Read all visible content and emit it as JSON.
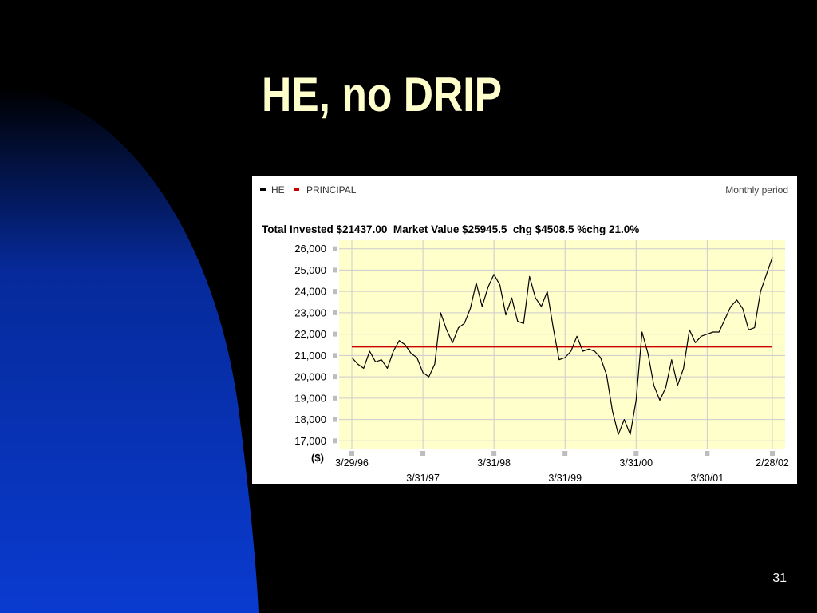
{
  "slide": {
    "title": "HE, no DRIP",
    "page_number": "31"
  },
  "chart_data": {
    "type": "line",
    "legend": [
      {
        "name": "HE",
        "color": "#000000"
      },
      {
        "name": "PRINCIPAL",
        "color": "#cc0000"
      }
    ],
    "period_label": "Monthly period",
    "summary": "Total Invested $21437.00  Market Value $25945.5  chg $4508.5 %chg 21.0%",
    "ylabel": "($)",
    "ylim": [
      16600,
      26400
    ],
    "y_ticks": [
      17000,
      18000,
      19000,
      20000,
      21000,
      22000,
      23000,
      24000,
      25000,
      26000
    ],
    "y_tick_labels": [
      "17,000",
      "18,000",
      "19,000",
      "20,000",
      "21,000",
      "22,000",
      "23,000",
      "24,000",
      "25,000",
      "26,000"
    ],
    "x_ticks": [
      {
        "index": 0,
        "label": "3/29/96",
        "row": 1
      },
      {
        "index": 12,
        "label": "3/31/97",
        "row": 2
      },
      {
        "index": 24,
        "label": "3/31/98",
        "row": 1
      },
      {
        "index": 36,
        "label": "3/31/99",
        "row": 2
      },
      {
        "index": 48,
        "label": "3/31/00",
        "row": 1
      },
      {
        "index": 60,
        "label": "3/30/01",
        "row": 2
      },
      {
        "index": 71,
        "label": "2/28/02",
        "row": 1
      }
    ],
    "series": [
      {
        "name": "HE",
        "color": "#000000",
        "values": [
          20900,
          20600,
          20400,
          21200,
          20700,
          20800,
          20400,
          21200,
          21700,
          21500,
          21100,
          20900,
          20200,
          20000,
          20600,
          23000,
          22200,
          21600,
          22300,
          22500,
          23200,
          24400,
          23300,
          24200,
          24800,
          24300,
          22900,
          23700,
          22600,
          22500,
          24700,
          23700,
          23300,
          24000,
          22300,
          20800,
          20900,
          21200,
          21900,
          21200,
          21300,
          21200,
          20900,
          20100,
          18400,
          17300,
          18000,
          17300,
          18900,
          22100,
          21100,
          19600,
          18900,
          19500,
          20800,
          19600,
          20400,
          22200,
          21600,
          21900,
          22000,
          22100,
          22100,
          22700,
          23300,
          23600,
          23200,
          22200,
          22300,
          24000,
          24800,
          25600
        ]
      },
      {
        "name": "PRINCIPAL",
        "color": "#cc0000",
        "values": [
          21400,
          21400
        ]
      }
    ],
    "grid": true,
    "background": "#ffffcc"
  }
}
